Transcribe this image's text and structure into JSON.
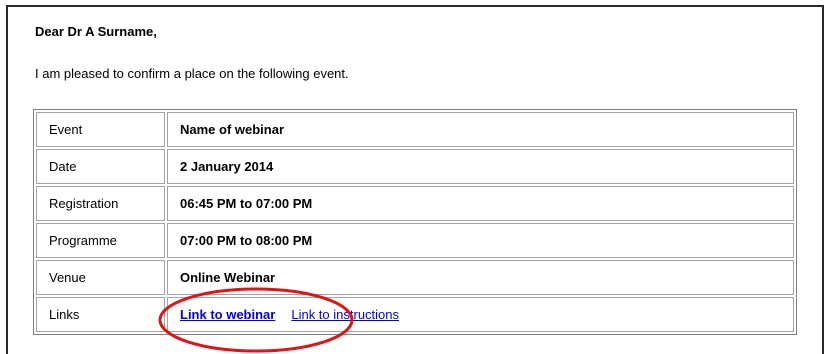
{
  "email": {
    "greeting": "Dear Dr A Surname,",
    "intro": "I am pleased to confirm a place on the following event."
  },
  "event_table": {
    "rows": [
      {
        "label": "Event",
        "value": "Name of webinar"
      },
      {
        "label": "Date",
        "value": "2 January 2014"
      },
      {
        "label": "Registration",
        "value": "06:45 PM to 07:00 PM"
      },
      {
        "label": "Programme",
        "value": "07:00 PM to 08:00 PM"
      },
      {
        "label": "Venue",
        "value": "Online Webinar"
      },
      {
        "label": "Links",
        "links": [
          "Link to webinar",
          "Link to instructions"
        ]
      }
    ]
  },
  "colors": {
    "link": "#0000ee",
    "annotation_circle": "#e01414",
    "frame_border": "#2a2a2a",
    "cell_border": "#a3a3a3"
  }
}
